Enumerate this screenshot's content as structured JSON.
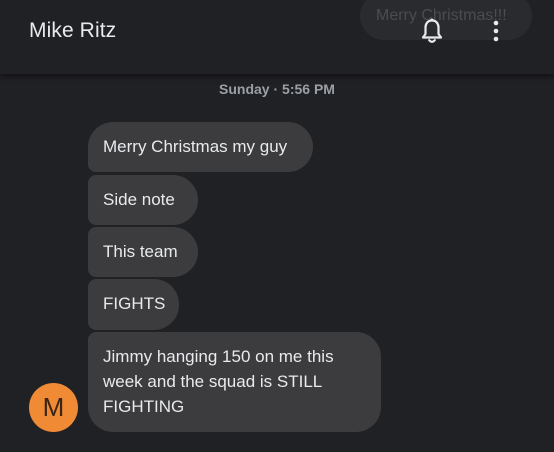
{
  "header": {
    "contact_name": "Mike Ritz",
    "background_bubble_text": "Merry Christmas!!!",
    "icons": [
      "bell-icon",
      "more-vertical-icon"
    ]
  },
  "conversation": {
    "timestamp": "Sunday · 5:56 PM",
    "messages": [
      {
        "text": "Merry Christmas my guy"
      },
      {
        "text": "Side note"
      },
      {
        "text": "This team"
      },
      {
        "text": "FIGHTS"
      },
      {
        "text": "Jimmy hanging 150 on me this week and the squad is STILL FIGHTING"
      }
    ],
    "avatar_initial": "M"
  },
  "colors": {
    "background": "#202124",
    "bubble": "#3c3c3f",
    "avatar": "#f08a34",
    "text": "#e8eaed",
    "timestamp": "#9aa0a6"
  }
}
